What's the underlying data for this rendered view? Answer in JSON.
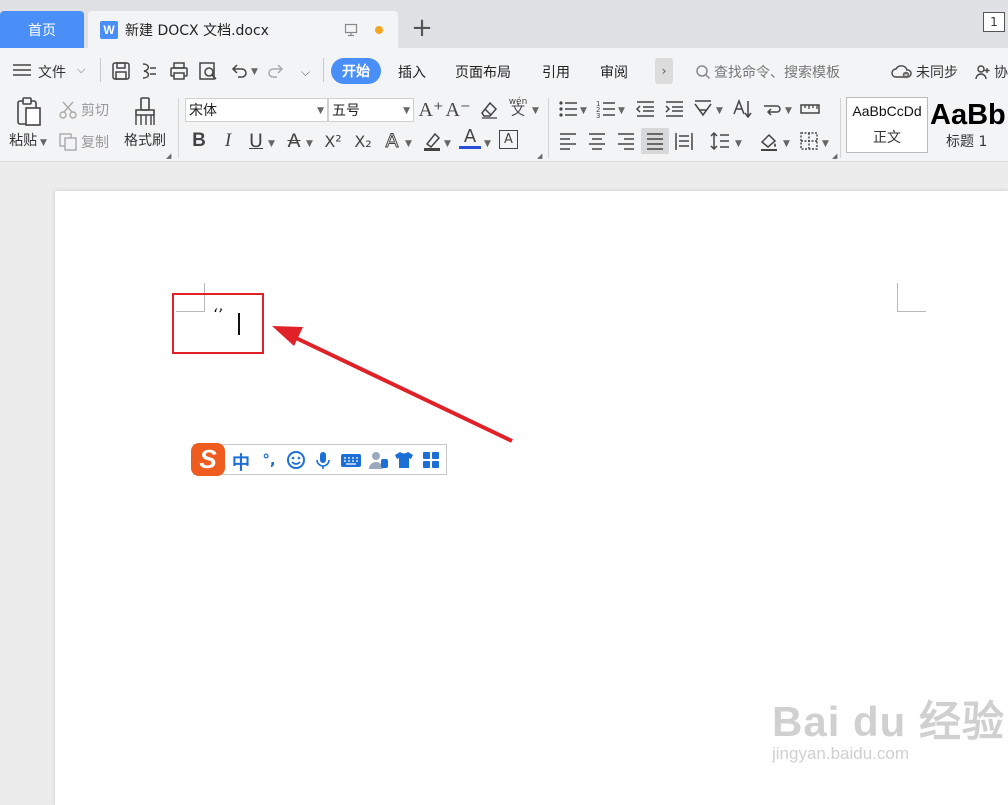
{
  "tabs": {
    "home_label": "首页",
    "doc_label": "新建 DOCX 文档.docx",
    "add_label": "+",
    "window_badge": "1"
  },
  "menu": {
    "file_label": "文件",
    "start_label": "开始",
    "items": [
      "插入",
      "页面布局",
      "引用",
      "审阅"
    ],
    "more_label": "›",
    "search_placeholder": "查找命令、搜索模板",
    "sync_label": "未同步",
    "collab_label": "协"
  },
  "ribbon": {
    "paste_label": "粘贴",
    "cut_label": "剪切",
    "copy_label": "复制",
    "format_painter_label": "格式刷",
    "font_name": "宋体",
    "font_size": "五号",
    "style_normal_preview": "AaBbCcDd",
    "style_normal_label": "正文",
    "style_heading_preview": "AaBb",
    "style_heading_label": "标题 1",
    "grow_font": "A⁺",
    "shrink_font": "A⁻",
    "bold": "B",
    "italic": "I",
    "underline": "U",
    "strike": "A",
    "superscript": "X²",
    "subscript": "X₂",
    "font_color": "A",
    "char_border": "A",
    "text_effect": "A",
    "wen_label": "wén"
  },
  "document": {
    "typed_text": "‘’"
  },
  "ime": {
    "logo": "S",
    "mode_label": "中",
    "punct_label": "°,"
  },
  "watermark": {
    "main": "Bai du 经验",
    "sub": "jingyan.baidu.com"
  },
  "colors": {
    "accent": "#4a8ff7",
    "highlight_box": "#e02127",
    "ime_logo": "#ef5c1f",
    "ime_icons": "#1d6fd8"
  }
}
